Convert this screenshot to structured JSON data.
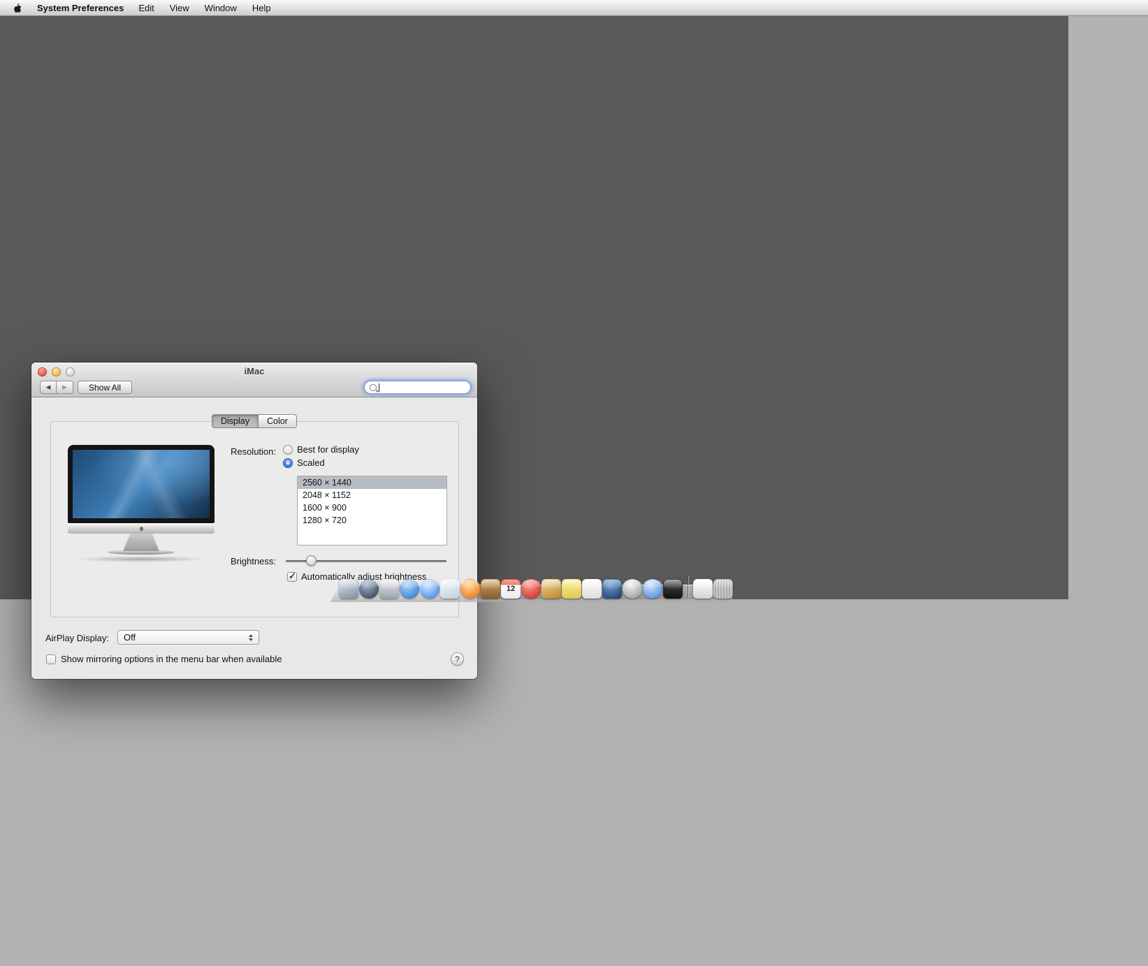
{
  "menu_bar": {
    "app_name": "System Preferences",
    "items": [
      "Edit",
      "View",
      "Window",
      "Help"
    ]
  },
  "window": {
    "title": "iMac",
    "toolbar": {
      "back_label": "◀",
      "forward_label": "▶",
      "show_all_label": "Show All",
      "search_value": ""
    },
    "tabs": {
      "display": "Display",
      "color": "Color"
    },
    "display_pane": {
      "resolution_label": "Resolution:",
      "radio_best_label": "Best for display",
      "radio_scaled_label": "Scaled",
      "selected_radio": "Scaled",
      "resolutions": [
        "2560 × 1440",
        "2048 × 1152",
        "1600 × 900",
        "1280 × 720"
      ],
      "selected_resolution": "2560 × 1440",
      "brightness_label": "Brightness:",
      "brightness_value_percent": 14,
      "auto_brightness_label": "Automatically adjust brightness",
      "auto_brightness_checked": true
    },
    "airplay_label": "AirPlay Display:",
    "airplay_value": "Off",
    "mirroring_label": "Show mirroring options in the menu bar when available",
    "mirroring_checked": false,
    "help_label": "?"
  },
  "dock": {
    "calendar_day": "12",
    "icons": [
      {
        "name": "displays-icon",
        "css": "background:linear-gradient(160deg,#dfe7ee,#7c8ea0)"
      },
      {
        "name": "launchpad-icon",
        "css": "background:radial-gradient(circle at 40% 30%,#9fb3c8,#27354a);border-radius:50%"
      },
      {
        "name": "mission-control-icon",
        "css": "background:linear-gradient(180deg,#ececec,#9aa2ac)"
      },
      {
        "name": "app-store-icon",
        "css": "background:radial-gradient(circle at 38% 30%,#aad4f7,#1f6fd0);border-radius:50%"
      },
      {
        "name": "safari-icon",
        "css": "background:radial-gradient(circle at 38% 30%,#cfe8ff,#2f7fe0);border-radius:50%"
      },
      {
        "name": "preview-icon",
        "css": "background:linear-gradient(160deg,#fafaf5,#bcd0e0)"
      },
      {
        "name": "firefox-icon",
        "css": "background:radial-gradient(circle at 42% 32%,#ffd78a,#e8650d);border-radius:50%"
      },
      {
        "name": "contacts-icon",
        "css": "background:linear-gradient(180deg,#d2a66d,#8a5a2a)"
      },
      {
        "name": "calendar-icon",
        "css": "background:linear-gradient(180deg,#e94b35 0%,#e94b35 30%,#fafafa 31%,#ececec 100%)"
      },
      {
        "name": "red-app-icon",
        "css": "background:radial-gradient(circle at 38% 30%,#ff9a8e,#c81e1a);border-radius:50%"
      },
      {
        "name": "gold-app-icon",
        "css": "background:linear-gradient(160deg,#f2dca2,#b8862a)"
      },
      {
        "name": "notes-icon",
        "css": "background:linear-gradient(180deg,#f9ec95,#e5c94f)"
      },
      {
        "name": "reminders-icon",
        "css": "background:linear-gradient(180deg,#ffffff,#dcdcdc)"
      },
      {
        "name": "photo-booth-icon",
        "css": "background:radial-gradient(circle at 40% 30%,#6f9fd8,#15355f)"
      },
      {
        "name": "silver-app-icon",
        "css": "background:radial-gradient(circle at 40% 30%,#f0f0f0,#8c9094);border-radius:50%"
      },
      {
        "name": "itunes-icon",
        "css": "background:radial-gradient(circle at 38% 30%,#cfe4ff,#3a7fd0);border-radius:50%"
      },
      {
        "name": "terminal-icon",
        "css": "background:linear-gradient(180deg,#4a4a4a,#101010)"
      },
      {
        "name": "documents-stack-icon",
        "css": "background:linear-gradient(180deg,#ffffff,#d0d4d8)"
      },
      {
        "name": "trash-icon",
        "css": "background:repeating-linear-gradient(90deg,#c9c9c9 0 2px,#a8a8a8 2px 4px)"
      }
    ]
  },
  "colors": {
    "desktop_dark": "#595959",
    "desktop_light": "#b2b2b2",
    "selection_gray": "#b7bdc3",
    "accent_blue": "#3a77d0"
  }
}
